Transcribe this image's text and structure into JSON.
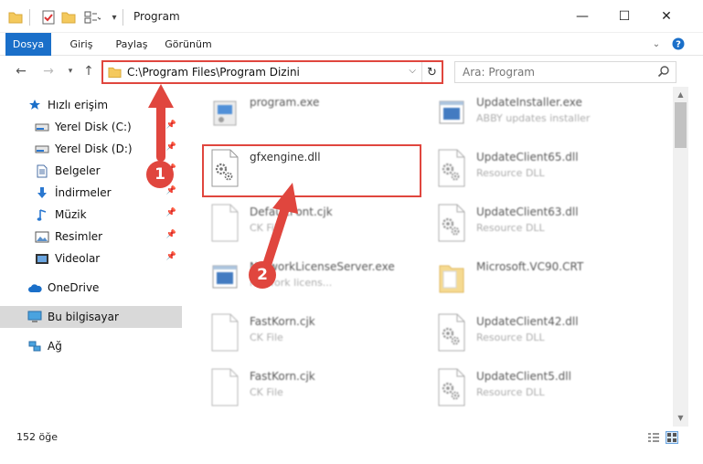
{
  "window": {
    "title": "Program",
    "minimize_symbol": "—",
    "maximize_symbol": "☐",
    "close_symbol": "✕"
  },
  "ribbon": {
    "tabs": [
      "Dosya",
      "Giriş",
      "Paylaş",
      "Görünüm"
    ]
  },
  "address_bar": {
    "path": "C:\\Program Files\\Program Dizini",
    "search_placeholder": "Ara: Program"
  },
  "sidebar": {
    "items": [
      {
        "label": "Hızlı erişim",
        "icon": "star-icon",
        "pinned": false
      },
      {
        "label": "Yerel Disk (C:)",
        "icon": "drive-icon",
        "pinned": true
      },
      {
        "label": "Yerel Disk (D:)",
        "icon": "drive-icon",
        "pinned": true
      },
      {
        "label": "Belgeler",
        "icon": "document-icon",
        "pinned": true
      },
      {
        "label": "İndirmeler",
        "icon": "download-icon",
        "pinned": true
      },
      {
        "label": "Müzik",
        "icon": "music-icon",
        "pinned": true
      },
      {
        "label": "Resimler",
        "icon": "picture-icon",
        "pinned": true
      },
      {
        "label": "Videolar",
        "icon": "video-icon",
        "pinned": true
      },
      {
        "label": "OneDrive",
        "icon": "cloud-icon",
        "pinned": false
      },
      {
        "label": "Bu bilgisayar",
        "icon": "computer-icon",
        "pinned": false,
        "selected": true
      },
      {
        "label": "Ağ",
        "icon": "network-icon",
        "pinned": false
      }
    ]
  },
  "files": {
    "left": [
      {
        "name": "program.exe",
        "desc": "",
        "icon": "exe-icon"
      },
      {
        "name": "gfxengine.dll",
        "desc": "",
        "icon": "dll-gear-icon",
        "highlighted": true
      },
      {
        "name": "DefaultFont.cjk",
        "desc": "CK File",
        "icon": "blank-file-icon"
      },
      {
        "name": "NetworkLicenseServer.exe",
        "desc": "network licens...",
        "icon": "exe-window-icon"
      },
      {
        "name": "FastKorn.cjk",
        "desc": "CK File",
        "icon": "blank-file-icon"
      },
      {
        "name": "FastKorn.cjk",
        "desc": "CK File",
        "icon": "blank-file-icon"
      }
    ],
    "right": [
      {
        "name": "UpdateInstaller.exe",
        "desc": "ABBY updates installer",
        "icon": "exe-window-icon"
      },
      {
        "name": "UpdateClient65.dll",
        "desc": "Resource DLL",
        "icon": "dll-gear-icon"
      },
      {
        "name": "UpdateClient63.dll",
        "desc": "Resource DLL",
        "icon": "dll-gear-icon"
      },
      {
        "name": "Microsoft.VC90.CRT",
        "desc": "",
        "icon": "folder-icon"
      },
      {
        "name": "UpdateClient42.dll",
        "desc": "Resource DLL",
        "icon": "dll-gear-icon"
      },
      {
        "name": "UpdateClient5.dll",
        "desc": "Resource DLL",
        "icon": "dll-gear-icon"
      }
    ]
  },
  "status": {
    "item_count": "152 öğe"
  },
  "annotations": {
    "step1": "1",
    "step2": "2",
    "color": "#e0463e"
  },
  "colors": {
    "accent": "#1a6fc9",
    "highlight": "#e0463e"
  }
}
